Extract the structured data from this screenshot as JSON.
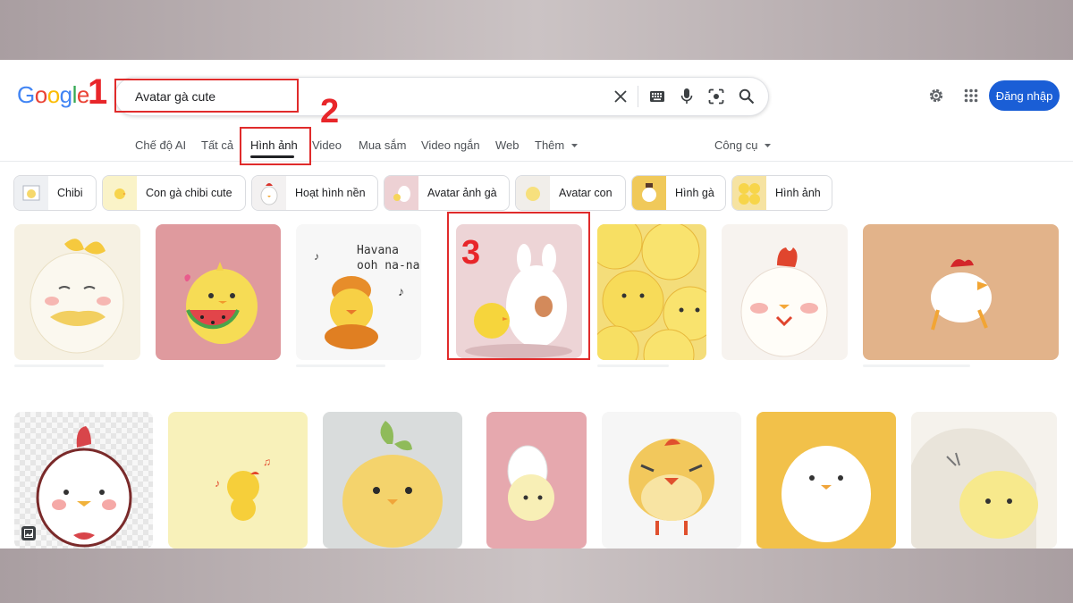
{
  "header": {
    "logo": [
      "G",
      "o",
      "o",
      "g",
      "l",
      "e"
    ],
    "search_value": "Avatar gà cute",
    "login_label": "Đăng nhập"
  },
  "markers": {
    "one": "1",
    "two": "2",
    "three": "3"
  },
  "tabs": [
    {
      "label": "Chế độ AI"
    },
    {
      "label": "Tất cả"
    },
    {
      "label": "Hình ảnh",
      "active": true
    },
    {
      "label": "Video"
    },
    {
      "label": "Mua sắm"
    },
    {
      "label": "Video ngắn"
    },
    {
      "label": "Web"
    },
    {
      "label": "Thêm"
    }
  ],
  "tools_label": "Công cụ",
  "chips": [
    {
      "label": "Chibi"
    },
    {
      "label": "Con gà chibi cute"
    },
    {
      "label": "Hoạt hình nền"
    },
    {
      "label": "Avatar ảnh gà"
    },
    {
      "label": "Avatar con"
    },
    {
      "label": "Hình gà"
    },
    {
      "label": "Hình ảnh"
    }
  ],
  "images": {
    "havana_text_1": "Havana",
    "havana_text_2": "ooh na-na"
  },
  "colors": {
    "accent_blue": "#1a5ed6",
    "marker_red": "#e8262a",
    "google_blue": "#4285f4",
    "google_red": "#ea4335",
    "google_yellow": "#fbbc05",
    "google_green": "#34a853"
  },
  "icons": [
    "clear-icon",
    "keyboard-icon",
    "microphone-icon",
    "lens-icon",
    "search-icon",
    "settings-gear-icon",
    "apps-grid-icon",
    "dropdown-caret-icon",
    "image-badge-icon"
  ]
}
